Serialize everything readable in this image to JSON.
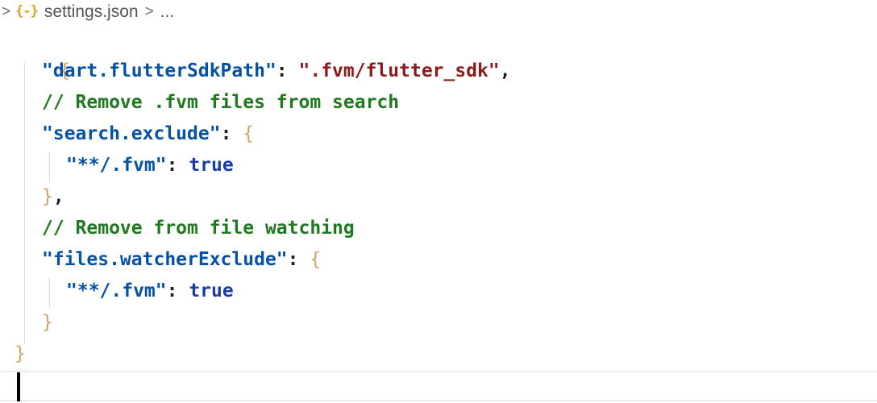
{
  "breadcrumb": {
    "chevron_start": ">",
    "file_icon": "{-}",
    "file_icon_name": "json-file-icon",
    "file_name": "settings.json",
    "chevron_mid": ">",
    "more": "..."
  },
  "editor": {
    "lines": {
      "open_brace": "{",
      "l1_key": "\"dart.flutterSdkPath\"",
      "l1_colon": ": ",
      "l1_value": "\".fvm/flutter_sdk\"",
      "l1_comma": ",",
      "l2_comment": "// Remove .fvm files from search",
      "l3_key": "\"search.exclude\"",
      "l3_colon": ": ",
      "l3_brace": "{",
      "l4_key": "\"**/.fvm\"",
      "l4_colon": ": ",
      "l4_value": "true",
      "l5_brace": "}",
      "l5_comma": ",",
      "l6_comment": "// Remove from file watching",
      "l7_key": "\"files.watcherExclude\"",
      "l7_colon": ": ",
      "l7_brace": "{",
      "l8_key": "\"**/.fvm\"",
      "l8_colon": ": ",
      "l8_value": "true",
      "l9_brace": "}",
      "close_brace": "}"
    }
  },
  "colors": {
    "key": "#0451a5",
    "string": "#8b1a1a",
    "keyword": "#1a3cab",
    "comment": "#1f7a1f",
    "brace": "#c9a66b"
  }
}
